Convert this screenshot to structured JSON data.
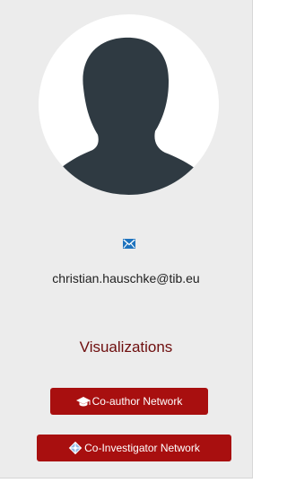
{
  "profile": {
    "email": "christian.hauschke@tib.eu",
    "avatar_icon": "person-silhouette-icon",
    "email_icon": "envelope-icon"
  },
  "visualizations": {
    "heading": "Visualizations",
    "coauthor_label": "Co-author Network",
    "coauthor_icon": "graduation-cap-icon",
    "coinvestigator_label": "Co-Investigator Network",
    "coinvestigator_icon": "network-diamond-icon"
  },
  "colors": {
    "accent": "#a80f0f",
    "heading": "#6e0e0e",
    "email_icon": "#1e73be",
    "avatar": "#2f3a42",
    "panel": "#ececec"
  }
}
